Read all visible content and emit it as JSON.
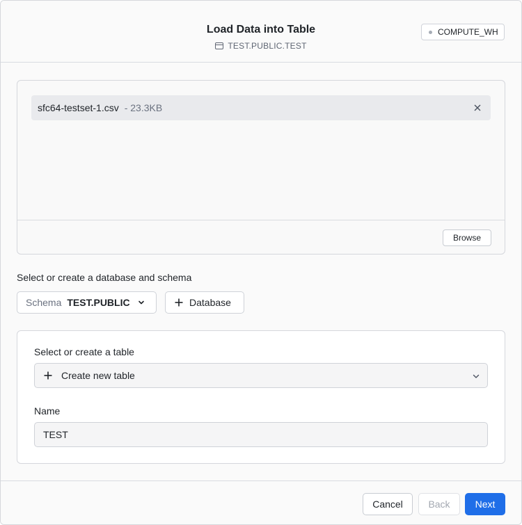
{
  "header": {
    "title": "Load Data into Table",
    "subtitle": "TEST.PUBLIC.TEST",
    "warehouse": "COMPUTE_WH"
  },
  "upload": {
    "file_name": "sfc64-testset-1.csv",
    "file_size": "- 23.3KB",
    "browse_label": "Browse"
  },
  "schema_section": {
    "label": "Select or create a database and schema",
    "schema_prefix": "Schema",
    "schema_value": "TEST.PUBLIC",
    "database_button": "Database"
  },
  "table_section": {
    "label": "Select or create a table",
    "selected_option": "Create new table",
    "name_label": "Name",
    "name_value": "TEST"
  },
  "footer": {
    "cancel": "Cancel",
    "back": "Back",
    "next": "Next"
  },
  "colors": {
    "primary": "#1f6ee8",
    "border": "#d5d7dc",
    "muted_text": "#6b7280"
  }
}
